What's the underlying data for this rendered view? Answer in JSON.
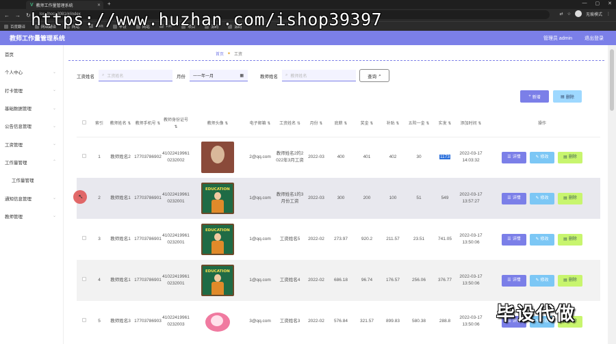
{
  "browser": {
    "tab_title": "教师工作量管理系统",
    "url": "localhost:8081/#/index",
    "incognito_label": "无痕模式",
    "bookmarks": [
      "百度翻译",
      "网络翻译",
      "网站",
      "Java",
      "毕设",
      "网站",
      "Vue",
      "项目",
      "源码",
      "源码"
    ]
  },
  "watermark": "https://www.huzhan.com/ishop39397",
  "app": {
    "title": "教师工作量管理系统",
    "admin": "管理员 admin",
    "logout": "退出登录"
  },
  "sidebar": {
    "items": [
      {
        "label": "首页"
      },
      {
        "label": "个人中心"
      },
      {
        "label": "打卡管理"
      },
      {
        "label": "基础数据管理"
      },
      {
        "label": "公告信息管理"
      },
      {
        "label": "工资管理"
      },
      {
        "label": "工作量管理"
      },
      {
        "label": "工作量管理"
      },
      {
        "label": "通知信息管理"
      },
      {
        "label": "教师管理"
      }
    ]
  },
  "breadcrumb": {
    "home": "首页",
    "current": "工资"
  },
  "search": {
    "salary_name_label": "工资姓名",
    "salary_name_placeholder": "工资姓名",
    "month_label": "月份",
    "month_placeholder": "一一年一月",
    "teacher_name_label": "教师姓名",
    "teacher_name_placeholder": "教师姓名",
    "query_button": "查询"
  },
  "actions": {
    "add": "新增",
    "delete": "删除"
  },
  "table": {
    "headers": [
      "索引",
      "教师姓名",
      "教师手机号",
      "教师身份证号",
      "教师头像",
      "电子邮箱",
      "工资姓名",
      "月份",
      "底薪",
      "奖金",
      "补贴",
      "五险一金",
      "实发",
      "添加时间",
      "操作"
    ],
    "row_buttons": {
      "detail": "详情",
      "edit": "修改",
      "delete": "删除"
    },
    "rows": [
      {
        "index": "1",
        "teacher": "教师姓名2",
        "phone": "17703786902",
        "idcard": "410224199610232002",
        "avatar": "old",
        "email": "2@qq.com",
        "salary_name": "教师姓名2的2022年3月工资",
        "month": "2022-03",
        "base": "400",
        "bonus": "401",
        "subsidy": "402",
        "insurance": "30",
        "actual": "1173",
        "time": "2022-03-17 14:03:32"
      },
      {
        "index": "2",
        "teacher": "教师姓名1",
        "phone": "17703786901",
        "idcard": "410224199610232001",
        "avatar": "board",
        "email": "1@qq.com",
        "salary_name": "教师姓名1的3月份工资",
        "month": "2022-03",
        "base": "300",
        "bonus": "200",
        "subsidy": "100",
        "insurance": "51",
        "actual": "549",
        "time": "2022-03-17 13:57:27"
      },
      {
        "index": "3",
        "teacher": "教师姓名1",
        "phone": "17703786901",
        "idcard": "410224199610232001",
        "avatar": "board",
        "email": "1@qq.com",
        "salary_name": "工资姓名5",
        "month": "2022-02",
        "base": "273.97",
        "bonus": "920.2",
        "subsidy": "211.57",
        "insurance": "23.51",
        "actual": "741.05",
        "time": "2022-03-17 13:50:06"
      },
      {
        "index": "4",
        "teacher": "教师姓名1",
        "phone": "17703786901",
        "idcard": "410224199610232001",
        "avatar": "board",
        "email": "1@qq.com",
        "salary_name": "工资姓名4",
        "month": "2022-02",
        "base": "686.18",
        "bonus": "96.74",
        "subsidy": "176.57",
        "insurance": "256.06",
        "actual": "376.77",
        "time": "2022-03-17 13:50:06"
      },
      {
        "index": "5",
        "teacher": "教师姓名3",
        "phone": "17703786903",
        "idcard": "410224199610232003",
        "avatar": "cake",
        "email": "3@qq.com",
        "salary_name": "工资姓名3",
        "month": "2022-02",
        "base": "576.84",
        "bonus": "321.57",
        "subsidy": "899.83",
        "insurance": "580.38",
        "actual": "288.8",
        "time": "2022-03-17 13:50:06"
      }
    ]
  },
  "corner_watermark": "毕设代做"
}
